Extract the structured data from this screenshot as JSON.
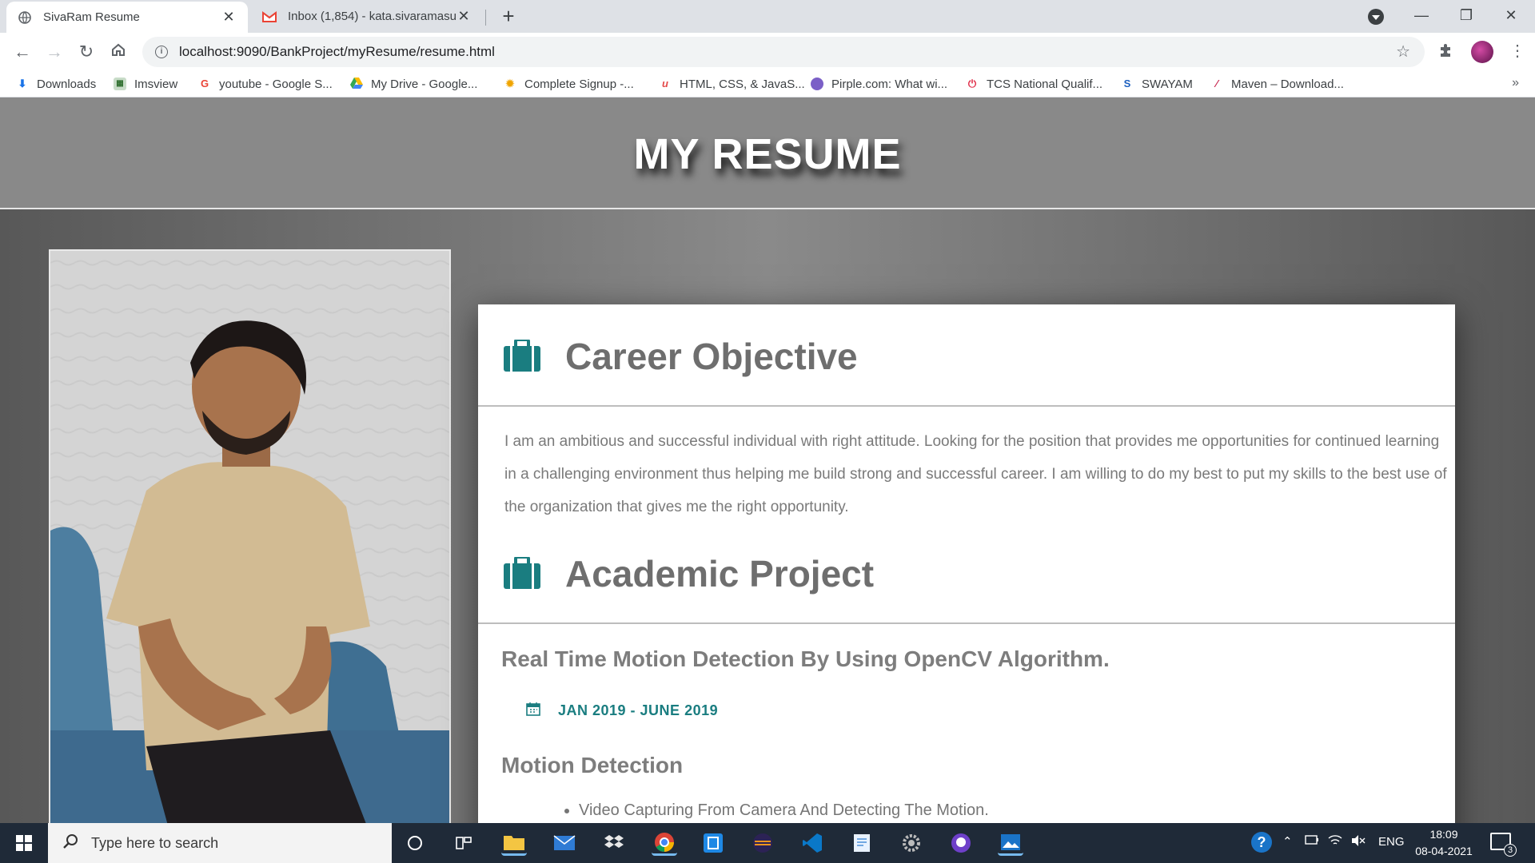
{
  "browser": {
    "tabs": [
      {
        "title": "SivaRam Resume",
        "icon": "globe-icon",
        "active": true
      },
      {
        "title": "Inbox (1,854) - kata.sivaramasub",
        "icon": "gmail-icon",
        "active": false
      }
    ],
    "new_tab_label": "+",
    "url": "localhost:9090/BankProject/myResume/resume.html",
    "bookmarks": [
      {
        "label": "Downloads",
        "icon": "download-icon"
      },
      {
        "label": "Imsview",
        "icon": "imsview-icon"
      },
      {
        "label": "youtube - Google S...",
        "icon": "google-icon"
      },
      {
        "label": "My Drive - Google...",
        "icon": "drive-icon"
      },
      {
        "label": "Complete Signup -...",
        "icon": "signup-icon"
      },
      {
        "label": "HTML, CSS, & JavaS...",
        "icon": "udemy-icon"
      },
      {
        "label": "Pirple.com: What wi...",
        "icon": "pirple-icon"
      },
      {
        "label": "TCS National Qualif...",
        "icon": "tcs-icon"
      },
      {
        "label": "SWAYAM",
        "icon": "swayam-icon"
      },
      {
        "label": "Maven – Download...",
        "icon": "maven-icon"
      }
    ],
    "bookmarks_more": "»"
  },
  "page": {
    "title": "MY RESUME",
    "sections": [
      {
        "heading": "Career Objective",
        "icon": "briefcase-icon",
        "text": "I am an ambitious and successful individual with right attitude. Looking for the position that provides me opportunities for continued learning in a challenging environment thus helping me build strong and successful career. I am willing to do my best to put my skills to the best use of the organization that gives me the right opportunity."
      },
      {
        "heading": "Academic Project",
        "icon": "briefcase-icon",
        "project_title": "Real Time Motion Detection By Using OpenCV Algorithm.",
        "date_range": "JAN 2019 - JUNE 2019",
        "subheading": "Motion Detection",
        "bullets": [
          "Video Capturing From Camera And Detecting The Motion."
        ]
      }
    ]
  },
  "taskbar": {
    "search_placeholder": "Type here to search",
    "language": "ENG",
    "time": "18:09",
    "date": "08-04-2021",
    "notification_count": "3"
  },
  "colors": {
    "accent_teal": "#1a7d80",
    "header_band": "#898989",
    "heading_gray": "#6e6e6e"
  }
}
